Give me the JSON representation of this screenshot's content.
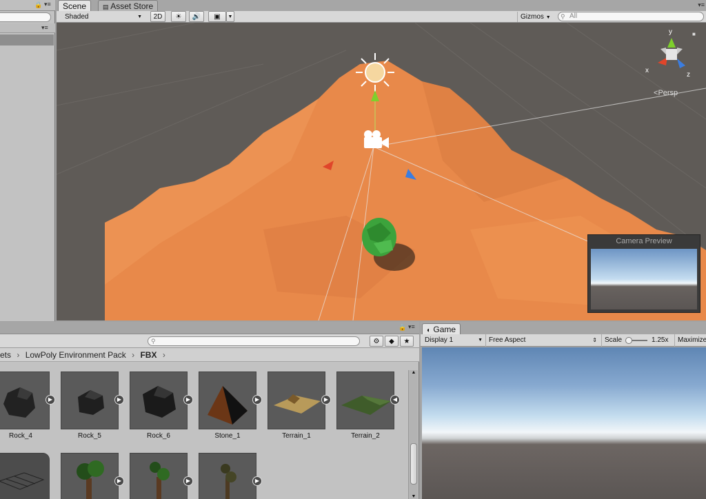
{
  "scene_tabs": {
    "scene": "Scene",
    "asset_store": "Asset Store"
  },
  "scene_toolbar": {
    "shading": "Shaded",
    "mode_2d": "2D",
    "gizmos": "Gizmos",
    "search_placeholder": "All"
  },
  "gizmo": {
    "y": "y",
    "x": "x",
    "z": "z",
    "persp": "Persp"
  },
  "camera_preview": {
    "title": "Camera Preview"
  },
  "project": {
    "breadcrumb": [
      "ets",
      "LowPoly Environment Pack",
      "FBX"
    ],
    "assets_row1": [
      "Rock_4",
      "Rock_5",
      "Rock_6",
      "Stone_1",
      "Terrain_1",
      "Terrain_2"
    ]
  },
  "game": {
    "tab": "Game",
    "display": "Display 1",
    "aspect": "Free Aspect",
    "scale_label": "Scale",
    "scale_value": "1.25x",
    "maximize": "Maximize"
  },
  "colors": {
    "terrain": "#e8894a",
    "scene_bg": "#5f5b57",
    "sky_top": "#5f86b4",
    "ground": "#5b5654"
  }
}
